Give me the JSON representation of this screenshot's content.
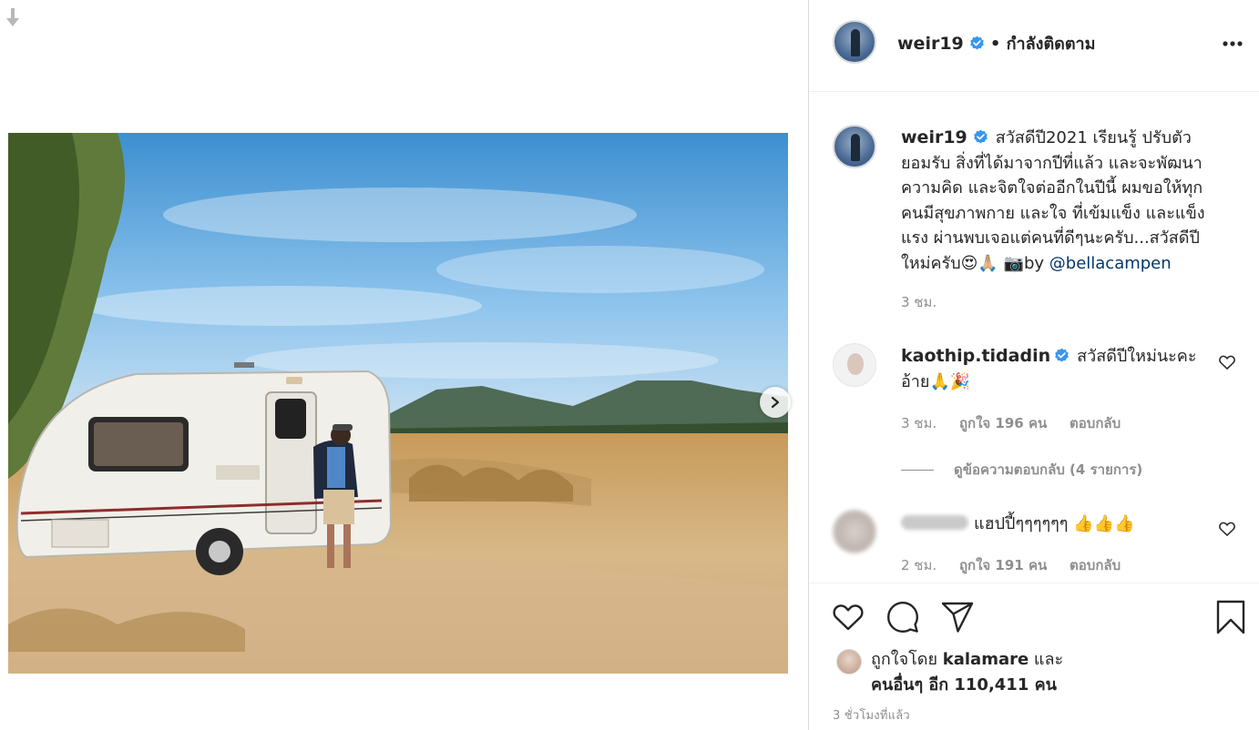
{
  "post": {
    "username": "weir19",
    "follow_status": "• กำลังติดตาม",
    "caption_lines": [
      "สวัสดีปี2021 เรียนรู้ ปรับตัว",
      "ยอมรับ สิ่งที่ได้มาจากปีที่แล้ว และจะพัฒนา",
      "ความคิด และจิตใจต่ออีกในปีนี้ ผมขอให้ทุก",
      "คนมีสุขภาพกาย และใจ ที่เข้มแข็ง และแข็ง",
      "แรง ผ่านพบเจอแต่คนที่ดีๆนะครับ...สวัสดีปี"
    ],
    "caption_last_prefix": "ใหม่ครับ😍🙏🏼 📷by ",
    "caption_mention": "@bellacampen",
    "caption_time": "3 ชม.",
    "timestamp": "3 ชั่วโมงที่แล้ว"
  },
  "comments": [
    {
      "username": "kaothip.tidadin",
      "line1": "สวัสดีปีใหม่นะคะ",
      "line2": "อ้าย🙏🎉",
      "time": "3 ชม.",
      "likes": "ถูกใจ 196 คน",
      "reply": "ตอบกลับ",
      "view_replies": "ดูข้อความตอบกลับ (4 รายการ)"
    },
    {
      "username": "",
      "text": "แฮปปี้ๆๆๆๆๆๆ 👍👍👍",
      "time": "2 ชม.",
      "likes": "ถูกใจ 191 คน",
      "reply": "ตอบกลับ"
    }
  ],
  "likes": {
    "prefix": "ถูกใจโดย ",
    "liker": "kalamare",
    "suffix": " และ",
    "others": "คนอื่นๆ อีก 110,411 คน"
  },
  "icons": {
    "like": "heart-icon",
    "comment": "comment-icon",
    "share": "share-icon",
    "save": "bookmark-icon",
    "more": "more-icon",
    "next": "chevron-right-icon",
    "download": "download-arrow-icon",
    "verified": "verified-badge-icon"
  },
  "colors": {
    "verified": "#3897f0",
    "mention": "#00376b",
    "secondary_text": "#8e8e8e",
    "border": "#dbdbdb"
  }
}
